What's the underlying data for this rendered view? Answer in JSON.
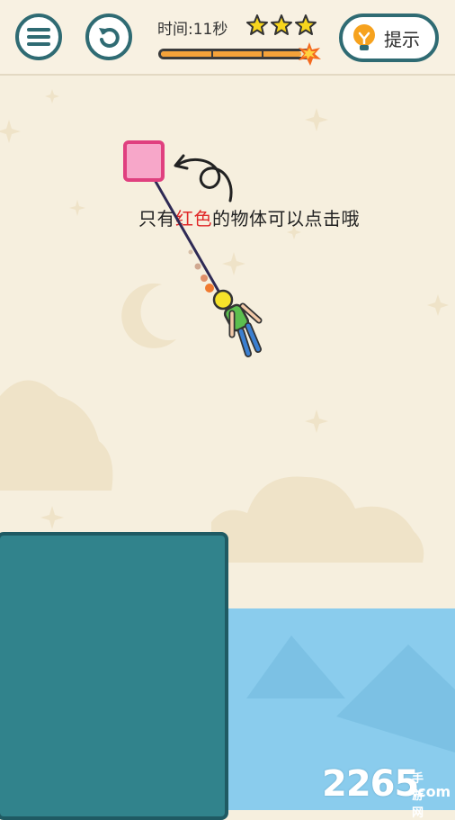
{
  "hud": {
    "timer_text": "时间:11秒",
    "stars_shown": 3,
    "time_progress": 0.95,
    "hint_label": "提示",
    "menu_icon": "hamburger-icon",
    "restart_icon": "restart-icon",
    "hint_icon": "lightbulb-icon"
  },
  "level": {
    "instruction_prefix": "只有",
    "instruction_highlight": "红色",
    "instruction_suffix": "的物体可以点击哦"
  },
  "watermark": {
    "main": "2265",
    "cn": "手游网",
    "com": ".com"
  },
  "colors": {
    "accent": "#2f6b73",
    "cliff": "#31838c",
    "water": "#8acced",
    "anchor_box": "#f7a7c9",
    "highlight_text": "#e02828",
    "star": "#f7d51d"
  }
}
